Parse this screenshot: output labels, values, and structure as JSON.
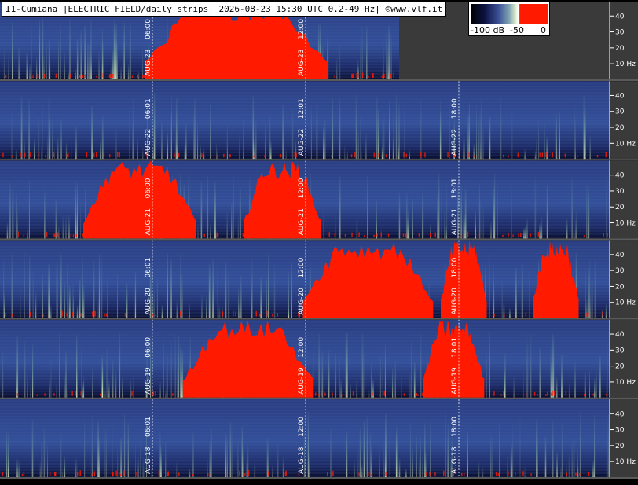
{
  "header": {
    "title": "I1-Cumiana |ELECTRIC FIELD/daily strips| 2026-08-23 15:30 UTC 0.2-49 Hz| ©www.vlf.it"
  },
  "colorbar": {
    "labels": [
      "-100 dB",
      "-50",
      "0"
    ],
    "colors": {
      "low": "#000000",
      "mid": "#7fa3b3",
      "high": "#ff1a00"
    }
  },
  "colors": {
    "background": "#1a2a6a",
    "axis_panel": "#3a3a3a",
    "intense": "#ff1a00",
    "emission": "#9fd3a8"
  },
  "chart_data": {
    "type": "heatmap",
    "description_type": "spectrogram strips",
    "frequency_range_hz": [
      0.2,
      49
    ],
    "yticks": [
      "40",
      "30",
      "20",
      "10 Hz"
    ],
    "strips": [
      {
        "date_label": "AUG-23",
        "time_markers": [
          "06:00",
          "12:00"
        ],
        "partial": true,
        "red_regions_hours": [
          [
            5.6,
            12.8
          ]
        ]
      },
      {
        "date_label": "AUG-22",
        "time_markers": [
          "06:01",
          "12:01",
          "18:00"
        ],
        "partial": false,
        "red_regions_hours": []
      },
      {
        "date_label": "AUG-21",
        "time_markers": [
          "06:00",
          "12:00",
          "18:01"
        ],
        "partial": false,
        "red_regions_hours": [
          [
            3.2,
            7.6
          ],
          [
            9.5,
            12.5
          ]
        ]
      },
      {
        "date_label": "AUG-20",
        "time_markers": [
          "06:01",
          "12:00",
          "18:00"
        ],
        "partial": false,
        "red_regions_hours": [
          [
            11.8,
            16.9
          ],
          [
            17.2,
            19.0
          ],
          [
            20.8,
            22.6
          ]
        ]
      },
      {
        "date_label": "AUG-19",
        "time_markers": [
          "06:00",
          "12:00",
          "18:01"
        ],
        "partial": false,
        "red_regions_hours": [
          [
            16.5,
            18.9
          ],
          [
            7.1,
            12.2
          ]
        ]
      },
      {
        "date_label": "AUG-18",
        "time_markers": [
          "06:01",
          "12:00",
          "18:00"
        ],
        "partial": false,
        "red_regions_hours": []
      }
    ]
  }
}
